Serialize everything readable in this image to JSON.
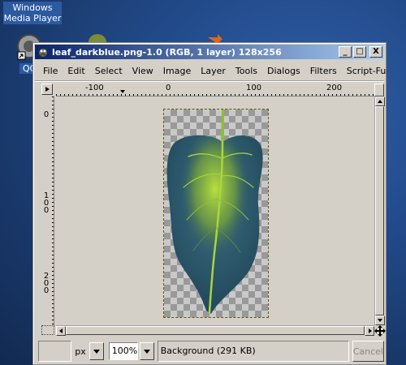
{
  "desktop": {
    "icons": [
      {
        "label": "Windows Media Player"
      },
      {
        "label": "QC"
      }
    ]
  },
  "window": {
    "title": "leaf_darkblue.png-1.0 (RGB, 1 layer) 128x256",
    "controls": {
      "minimize": "_",
      "maximize": "□",
      "close": "X"
    }
  },
  "menu": {
    "items": [
      "File",
      "Edit",
      "Select",
      "View",
      "Image",
      "Layer",
      "Tools",
      "Dialogs",
      "Filters",
      "Script-Fu"
    ]
  },
  "ruler": {
    "horizontal": [
      "-100",
      "0",
      "100",
      "200"
    ],
    "vertical": [
      "0",
      "100",
      "200"
    ]
  },
  "statusbar": {
    "coords": "",
    "unit": "px",
    "zoom": "100%",
    "message": "Background (291 KB)",
    "cancel_label": "Cancel"
  },
  "colors": {
    "leaf": "#2f5b6e",
    "vein": "#a8d23c",
    "checker_dark": "#999999",
    "checker_light": "#c9c9c9"
  }
}
